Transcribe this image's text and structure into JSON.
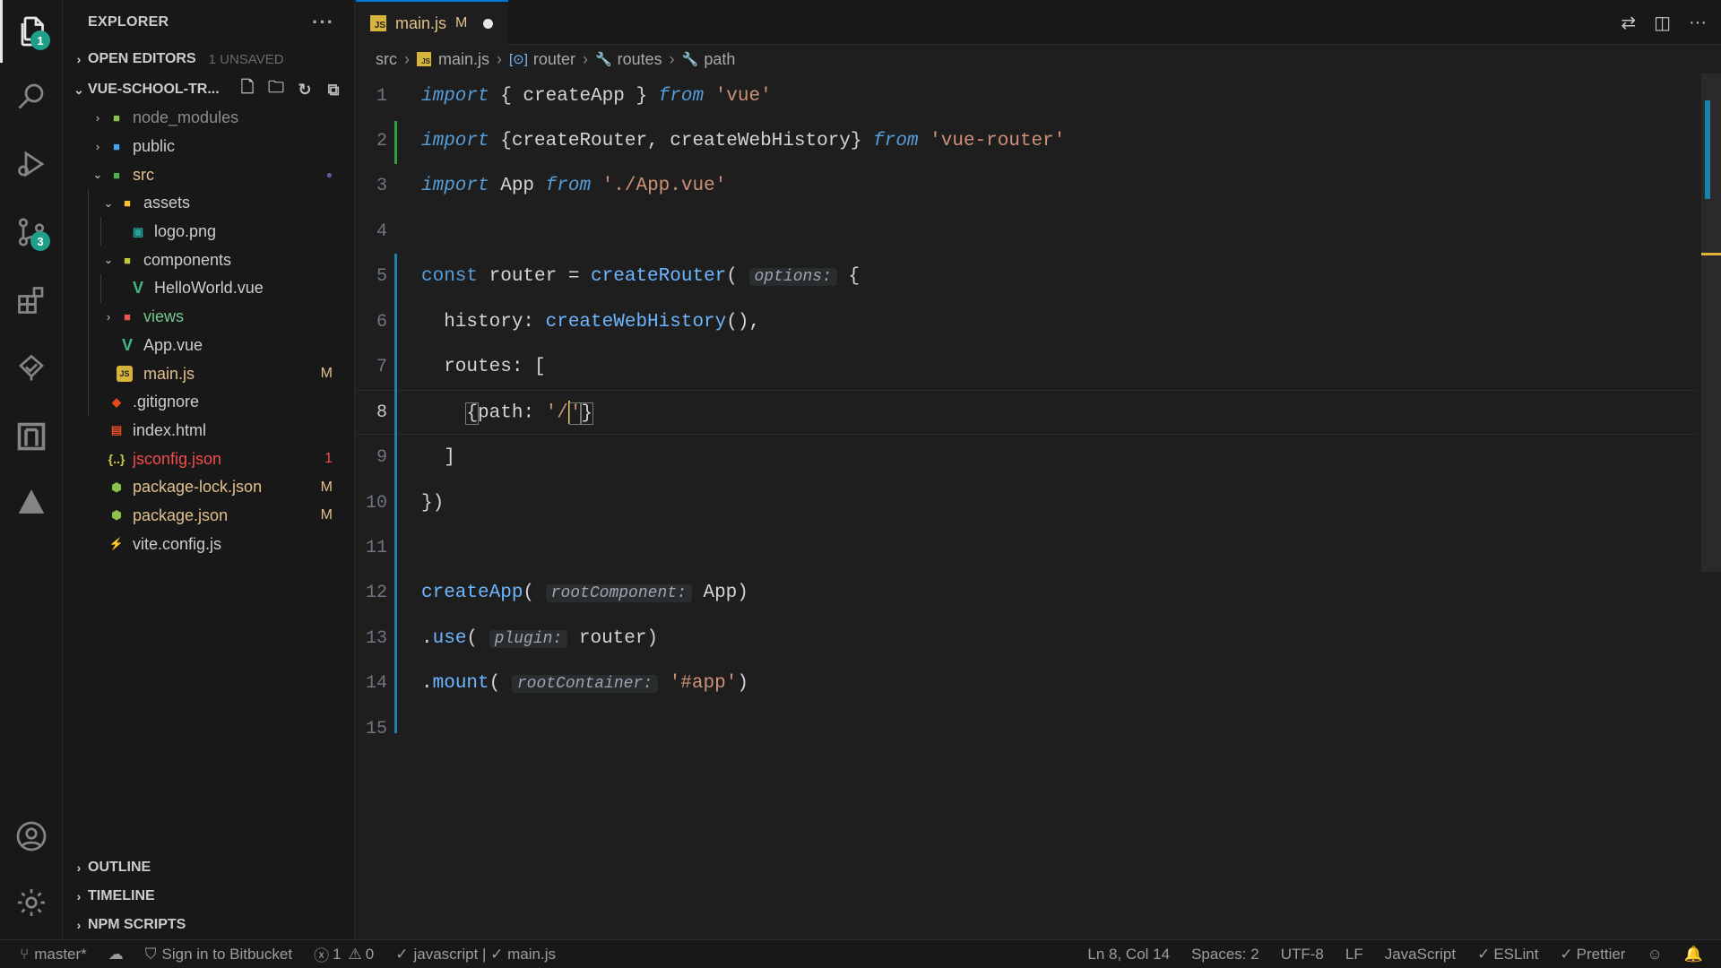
{
  "activity": {
    "explorer_badge": "1",
    "scm_badge": "3"
  },
  "sidebar": {
    "title": "EXPLORER",
    "more": "···",
    "open_editors": "OPEN EDITORS",
    "unsaved": "1 UNSAVED",
    "project": "VUE-SCHOOL-TR...",
    "tree": [
      {
        "label": "node_modules",
        "status": ""
      },
      {
        "label": "public",
        "status": ""
      },
      {
        "label": "src",
        "status": "●"
      },
      {
        "label": "assets",
        "status": ""
      },
      {
        "label": "logo.png",
        "status": ""
      },
      {
        "label": "components",
        "status": ""
      },
      {
        "label": "HelloWorld.vue",
        "status": ""
      },
      {
        "label": "views",
        "status": ""
      },
      {
        "label": "App.vue",
        "status": ""
      },
      {
        "label": "main.js",
        "status": "M"
      },
      {
        "label": ".gitignore",
        "status": ""
      },
      {
        "label": "index.html",
        "status": ""
      },
      {
        "label": "jsconfig.json",
        "status": "1"
      },
      {
        "label": "package-lock.json",
        "status": "M"
      },
      {
        "label": "package.json",
        "status": "M"
      },
      {
        "label": "vite.config.js",
        "status": ""
      }
    ],
    "outline": "OUTLINE",
    "timeline": "TIMELINE",
    "npm_scripts": "NPM SCRIPTS"
  },
  "tab": {
    "filename": "main.js",
    "status": "M",
    "icon_text": "JS"
  },
  "breadcrumb": [
    "src",
    "main.js",
    "router",
    "routes",
    "path"
  ],
  "code": {
    "line_numbers": [
      "1",
      "2",
      "3",
      "4",
      "5",
      "6",
      "7",
      "8",
      "9",
      "10",
      "11",
      "12",
      "13",
      "14",
      "15"
    ],
    "hints": {
      "options": "options:",
      "rootComponent": "rootComponent:",
      "plugin": "plugin:",
      "rootContainer": "rootContainer:"
    }
  },
  "statusbar": {
    "branch": "master*",
    "signin": "Sign in to Bitbucket",
    "errors": "1",
    "warnings": "0",
    "lint_scope": "javascript | ✓ main.js",
    "position": "Ln 8, Col 14",
    "spaces": "Spaces: 2",
    "encoding": "UTF-8",
    "eol": "LF",
    "language": "JavaScript",
    "eslint": "ESLint",
    "prettier": "Prettier"
  }
}
